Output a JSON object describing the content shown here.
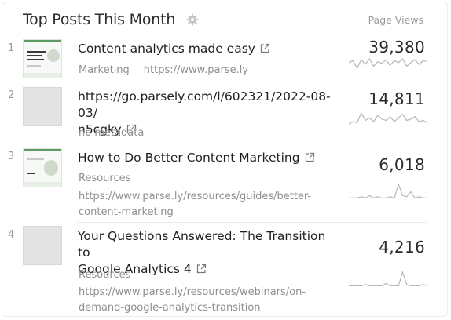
{
  "widget": {
    "title": "Top Posts This Month",
    "column_label": "Page Views"
  },
  "posts": [
    {
      "rank": "1",
      "title": "Content analytics made easy",
      "section": "Marketing",
      "url": "https://www.parse.ly",
      "views": "39,380",
      "thumbnail": "screenshot",
      "sparkline": [
        12,
        14,
        6,
        15,
        10,
        16,
        8,
        13,
        11,
        15,
        9,
        14,
        12,
        16,
        8,
        12,
        15,
        10,
        14,
        13
      ]
    },
    {
      "rank": "2",
      "title_line1": "https://go.parsely.com/l/602321/2022-08-03/",
      "title_line2": "n5cgky",
      "metadata_note": "no metadata",
      "views": "14,811",
      "thumbnail": "blank",
      "sparkline": [
        3,
        5,
        4,
        12,
        6,
        8,
        5,
        10,
        7,
        6,
        9,
        5,
        8,
        11,
        6,
        7,
        9,
        5,
        6,
        4
      ]
    },
    {
      "rank": "3",
      "title": "How to Do Better Content Marketing",
      "section": "Resources",
      "url_line1": "https://www.parse.ly/resources/guides/better-",
      "url_line2": "content-marketing",
      "views": "6,018",
      "thumbnail": "screenshot",
      "sparkline": [
        1,
        1,
        1,
        2,
        1,
        3,
        1,
        2,
        1,
        1,
        2,
        1,
        12,
        3,
        2,
        6,
        1,
        2,
        1,
        1
      ]
    },
    {
      "rank": "4",
      "title_line1": "Your Questions Answered: The Transition to",
      "title_line2": "Google Analytics 4",
      "section": "Resources",
      "url_line1": "https://www.parse.ly/resources/webinars/on-",
      "url_line2": "demand-google-analytics-transition",
      "views": "4,216",
      "thumbnail": "blank",
      "sparkline": [
        1,
        1,
        1,
        1,
        2,
        1,
        1,
        1,
        1,
        3,
        1,
        1,
        1,
        12,
        2,
        1,
        1,
        1,
        2,
        1
      ]
    }
  ],
  "colors": {
    "sparkline": "#b7b7b7",
    "muted_text": "#8f8f8f",
    "thumbnail_placeholder": "#e3e3e3"
  },
  "icons": [
    "gear-icon",
    "external-link-icon"
  ]
}
